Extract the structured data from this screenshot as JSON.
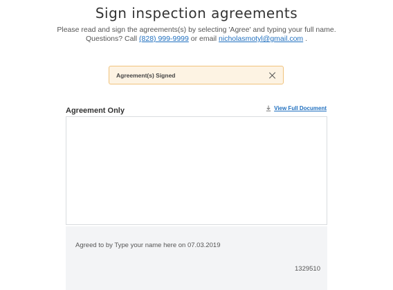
{
  "header": {
    "title": "Sign inspection agreements",
    "instructions": "Please read and sign the agreements(s) by selecting 'Agree' and typing your full name.",
    "questions_prefix": "Questions? Call",
    "phone": "(828) 999-9999",
    "or_email": "or email",
    "email": "nicholasmotyl@gmail.com",
    "trailing_period": "."
  },
  "alert": {
    "message": "Agreement(s) Signed",
    "close_icon": "close-icon"
  },
  "agreement": {
    "title": "Agreement Only",
    "view_full_label": "View Full Document",
    "download_icon": "download-icon"
  },
  "signature": {
    "agreed_text": "Agreed to by Type your name here on 07.03.2019",
    "code": "1329510"
  }
}
